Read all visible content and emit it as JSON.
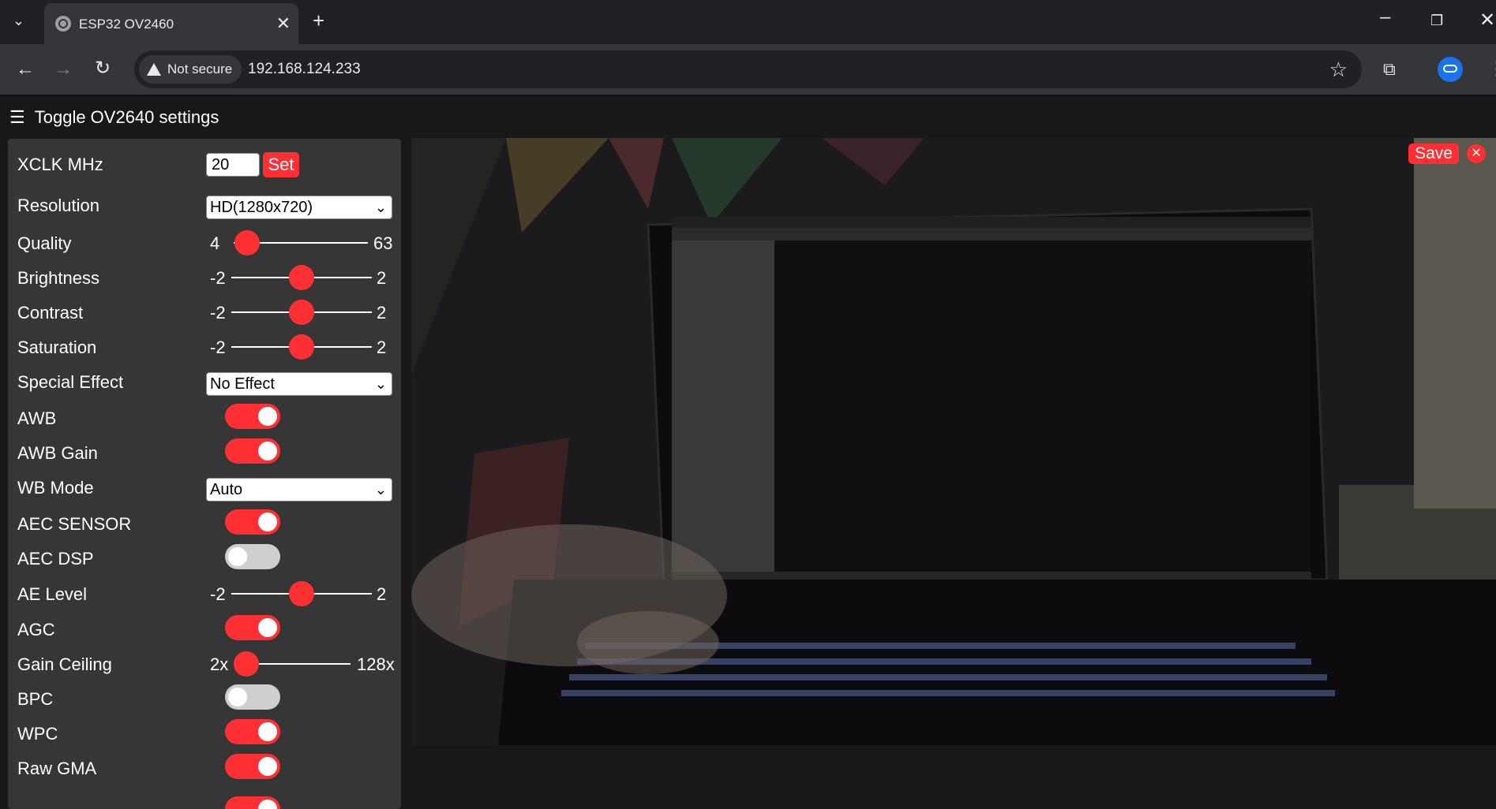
{
  "browser": {
    "tab_title": "ESP32 OV2460",
    "security_label": "Not secure",
    "url": "192.168.124.233"
  },
  "page": {
    "menu_label": "Toggle OV2640 settings",
    "save_label": "Save"
  },
  "settings": {
    "xclk": {
      "label": "XCLK MHz",
      "value": "20",
      "button": "Set"
    },
    "resolution": {
      "label": "Resolution",
      "value": "HD(1280x720)"
    },
    "quality": {
      "label": "Quality",
      "min": "4",
      "max": "63",
      "value": 10
    },
    "brightness": {
      "label": "Brightness",
      "min": "-2",
      "max": "2",
      "value": 0
    },
    "contrast": {
      "label": "Contrast",
      "min": "-2",
      "max": "2",
      "value": 0
    },
    "saturation": {
      "label": "Saturation",
      "min": "-2",
      "max": "2",
      "value": 0
    },
    "special_effect": {
      "label": "Special Effect",
      "value": "No Effect"
    },
    "awb": {
      "label": "AWB",
      "on": true
    },
    "awb_gain": {
      "label": "AWB Gain",
      "on": true
    },
    "wb_mode": {
      "label": "WB Mode",
      "value": "Auto"
    },
    "aec_sensor": {
      "label": "AEC SENSOR",
      "on": true
    },
    "aec_dsp": {
      "label": "AEC DSP",
      "on": false
    },
    "ae_level": {
      "label": "AE Level",
      "min": "-2",
      "max": "2",
      "value": 0
    },
    "agc": {
      "label": "AGC",
      "on": true
    },
    "gain_ceiling": {
      "label": "Gain Ceiling",
      "min": "2x",
      "max": "128x",
      "fraction": 0
    },
    "bpc": {
      "label": "BPC",
      "on": false
    },
    "wpc": {
      "label": "WPC",
      "on": true
    },
    "raw_gma": {
      "label": "Raw GMA",
      "on": true
    }
  },
  "colors": {
    "accent": "#ff3034",
    "panel": "#363636",
    "background": "#181818"
  }
}
